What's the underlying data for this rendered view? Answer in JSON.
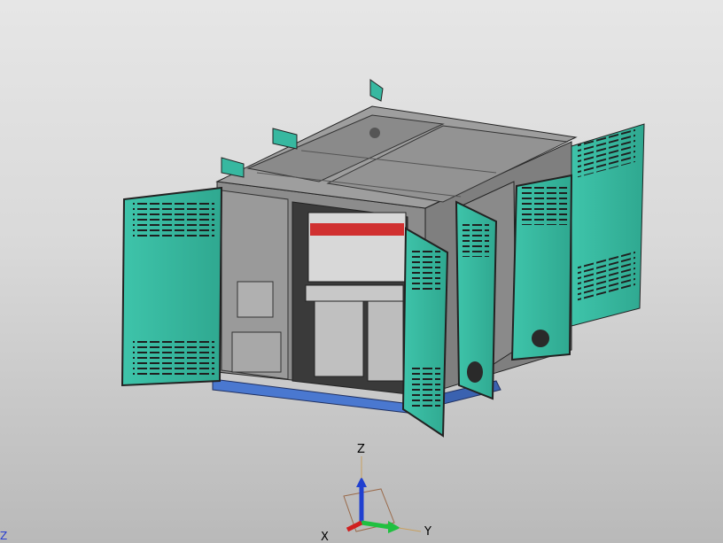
{
  "viewport": {
    "background_top": "#e6e6e6",
    "background_bottom": "#b9b9b9"
  },
  "model": {
    "description_icon": "3d-cad-cabinet-model",
    "door_color": "#37b8a0",
    "door_shadow_color": "#2a8f7e",
    "frame_color": "#8a8a8a",
    "base_color": "#4a78d0",
    "roof_color": "#9a9a9a"
  },
  "triad": {
    "x_label": "X",
    "y_label": "Y",
    "z_label": "Z",
    "x_color": "#d02020",
    "y_color": "#20c040",
    "z_color": "#2040d0"
  },
  "corner_mark": "Z"
}
